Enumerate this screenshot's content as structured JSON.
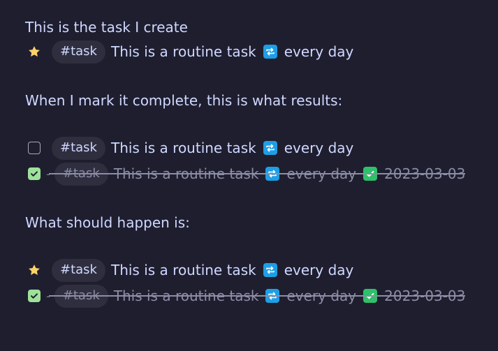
{
  "colors": {
    "background": "#1f1e2f",
    "text": "#cfd8ff",
    "muted": "#8c8da6",
    "tag_background": "#2f2e3f",
    "star": "#fbd26a",
    "repeat_emoji": "#1e9ee5",
    "check_emoji": "#2fc06a",
    "checkbox_done": "#9ee29a"
  },
  "paragraphs": {
    "intro": "This is the task I create",
    "result": "When I mark it complete, this is what results:",
    "expected": "What should happen is:"
  },
  "created_task": {
    "bullet_icon": "star-icon",
    "tag": "#task",
    "text": "This is a routine task",
    "recurrence": "every day"
  },
  "result_tasks": [
    {
      "status": "open",
      "tag": "#task",
      "text": "This is a routine task",
      "recurrence": "every day"
    },
    {
      "status": "done",
      "tag": "#task",
      "text": "This is a routine task",
      "recurrence": "every day",
      "done_date": "2023-03-03"
    }
  ],
  "expected_tasks": [
    {
      "status": "star",
      "tag": "#task",
      "text": "This is a routine task",
      "recurrence": "every day"
    },
    {
      "status": "done",
      "tag": "#task",
      "text": "This is a routine task",
      "recurrence": "every day",
      "done_date": "2023-03-03"
    }
  ]
}
